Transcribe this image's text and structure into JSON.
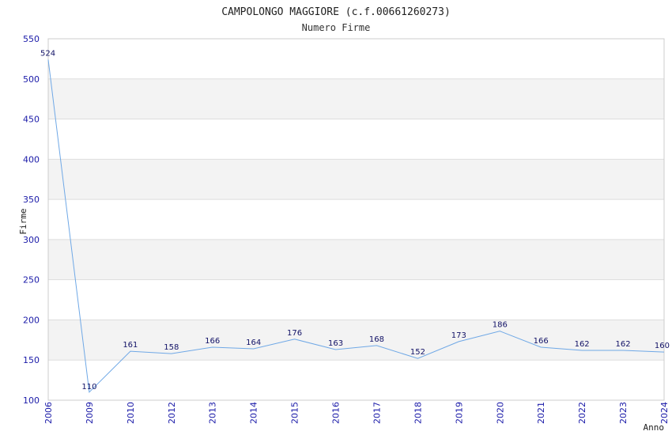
{
  "chart_data": {
    "type": "line",
    "title": "CAMPOLONGO MAGGIORE (c.f.00661260273)",
    "subtitle": "Numero Firme",
    "xlabel": "Anno",
    "ylabel": "Firme",
    "categories": [
      "2006",
      "2009",
      "2010",
      "2012",
      "2013",
      "2014",
      "2015",
      "2016",
      "2017",
      "2018",
      "2019",
      "2020",
      "2021",
      "2022",
      "2023",
      "2024"
    ],
    "series": [
      {
        "values": [
          524,
          110,
          161,
          158,
          166,
          164,
          176,
          163,
          168,
          152,
          173,
          186,
          166,
          162,
          162,
          160
        ]
      }
    ],
    "ylim": [
      100,
      550
    ],
    "yticks": [
      100,
      150,
      200,
      250,
      300,
      350,
      400,
      450,
      500,
      550
    ],
    "grid": true,
    "banded_background": true,
    "line_color": "#6fa8e6",
    "tick_color": "#1a1aa8"
  }
}
